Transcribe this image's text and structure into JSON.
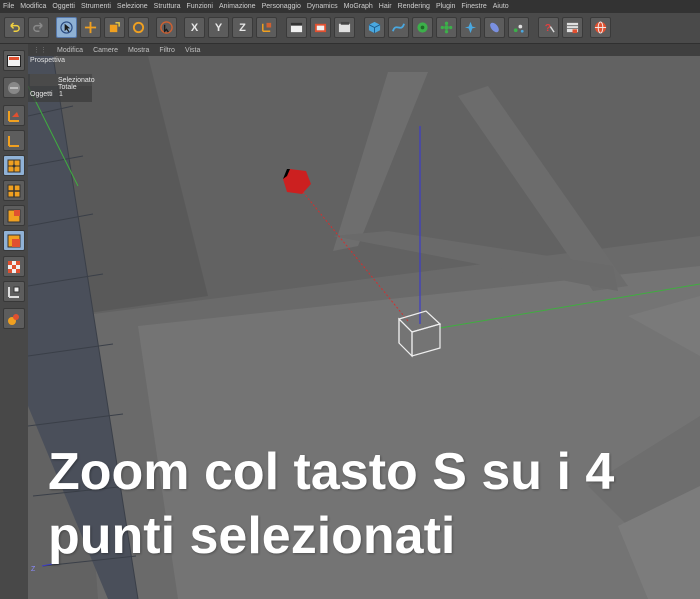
{
  "menu": [
    "File",
    "Modifica",
    "Oggetti",
    "Strumenti",
    "Selezione",
    "Struttura",
    "Funzioni",
    "Animazione",
    "Personaggio",
    "Dynamics",
    "MoGraph",
    "Hair",
    "Rendering",
    "Plugin",
    "Finestre",
    "Aiuto"
  ],
  "toolbar": {
    "axis_x": "X",
    "axis_y": "Y",
    "axis_z": "Z"
  },
  "view_menu": [
    "Modifica",
    "Camere",
    "Mostra",
    "Filtro",
    "Vista"
  ],
  "viewport": {
    "label": "Prospettiva",
    "hud_title": "Selezionato Totale",
    "hud_row_label": "Oggetti",
    "hud_row_value": "1",
    "axis_gizmo_label": "Z"
  },
  "caption": {
    "line1": "Zoom col tasto S su i 4",
    "line2": "punti selezionati"
  },
  "colors": {
    "accent_blue": "#8fb1d4",
    "axis_red": "#d23030",
    "axis_green": "#3fae3f",
    "axis_blue": "#3c3cc8"
  }
}
